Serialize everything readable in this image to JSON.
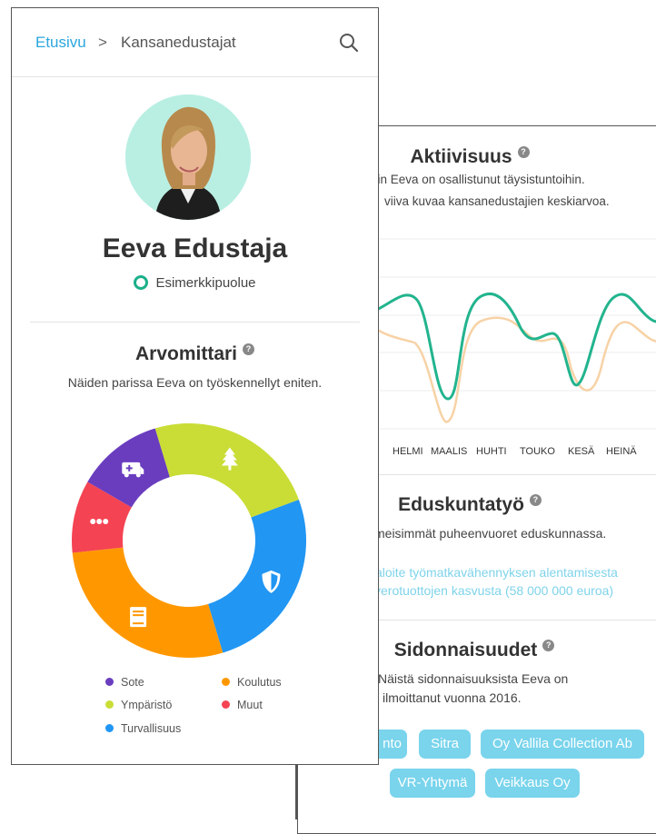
{
  "breadcrumb": {
    "home": "Etusivu",
    "separator": ">",
    "current": "Kansanedustajat"
  },
  "profile": {
    "name": "Eeva Edustaja",
    "party": "Esimerkkipuolue"
  },
  "arvomittari": {
    "title": "Arvomittari",
    "help": "?",
    "subtitle": "Näiden parissa Eeva on työskennellyt eniten.",
    "segments": [
      {
        "label": "Sote",
        "color": "#6a3dbf",
        "value": 12,
        "icon": "ambulance-icon"
      },
      {
        "label": "Ympäristö",
        "color": "#c9dd36",
        "value": 24,
        "icon": "tree-icon"
      },
      {
        "label": "Turvallisuus",
        "color": "#2196f3",
        "value": 26,
        "icon": "shield-icon"
      },
      {
        "label": "Koulutus",
        "color": "#ff9800",
        "value": 28,
        "icon": "book-icon"
      },
      {
        "label": "Muut",
        "color": "#f44352",
        "value": 10,
        "icon": "more-icon"
      }
    ]
  },
  "aktiivisuus": {
    "title": "Aktiivisuus",
    "help": "?",
    "line1": "ein Eeva on osallistunut täysistuntoihin.",
    "line2": "viiva kuvaa kansanedustajien keskiarvoa.",
    "months": [
      "HELMI",
      "MAALIS",
      "HUHTI",
      "TOUKO",
      "KESÄ",
      "HEINÄ"
    ]
  },
  "eduskuntatyo": {
    "title": "Eduskuntatyö",
    "help": "?",
    "subtitle": "meisimmät puheenvuoret eduskunnassa.",
    "link1": "aloite työmatkavähennyksen alentamisesta",
    "link2": "verotuottojen kasvusta (58 000 000 euroa)"
  },
  "sidonnaisuudet": {
    "title": "Sidonnaisuudet",
    "help": "?",
    "line1": "Näistä sidonnaisuuksista Eeva on",
    "line2": "ilmoittanut vuonna 2016.",
    "chips": [
      "nto",
      "Sitra",
      "Oy Vallila Collection Ab",
      "VR-Yhtymä",
      "Veikkaus Oy"
    ]
  },
  "colors": {
    "accent": "#2ba6de",
    "party": "#1bb08a",
    "member_line": "#22b48e",
    "average_line": "#f7d2a6",
    "chip": "#79d4ec"
  }
}
